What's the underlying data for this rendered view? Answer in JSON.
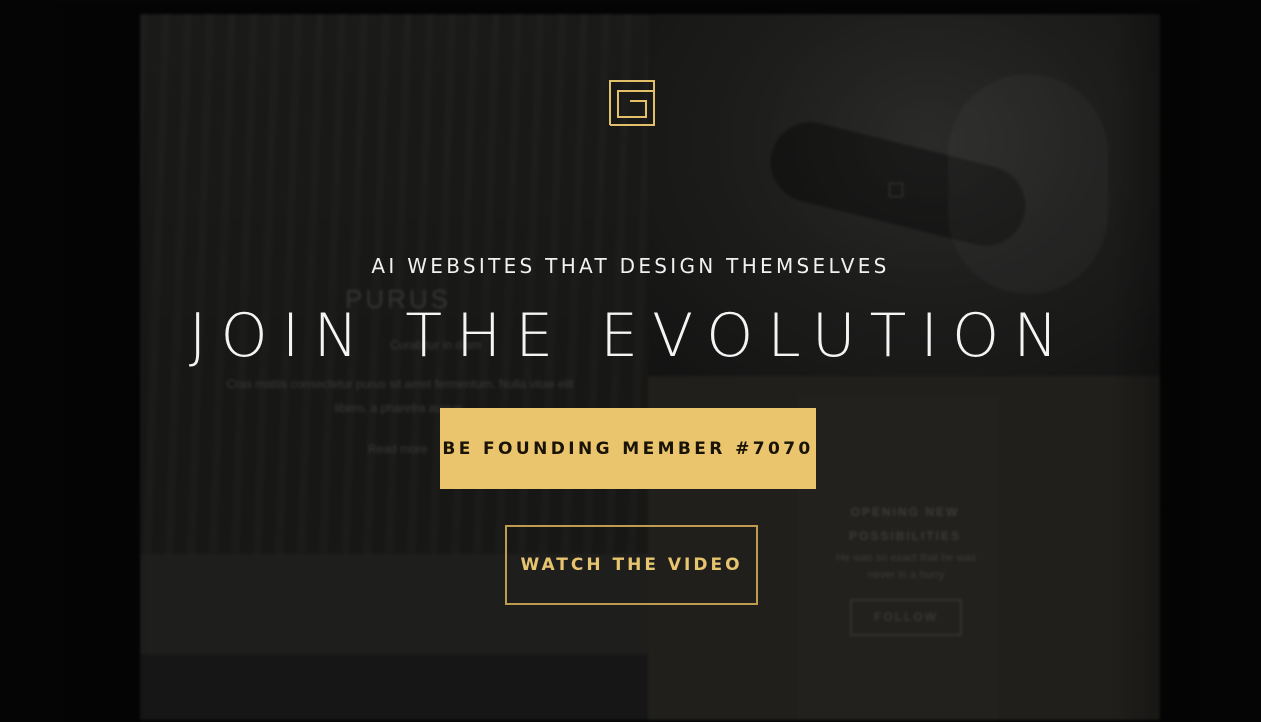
{
  "background_mockup": {
    "left_heading": "PURUS",
    "left_subheading": "Curabitur in diam",
    "left_body": "Cras mattis consectetur purus sit amet fermentum. Nulla vitae elit libero, a pharetra augue.",
    "left_link": "Read more",
    "right_heading": "OPENING NEW POSSIBILITIES",
    "right_body": "He was so exact that he was never in a hurry",
    "right_button": "FOLLOW"
  },
  "hero": {
    "logo_icon": "g-logo-icon",
    "tagline": "AI WEBSITES THAT DESIGN THEMSELVES",
    "headline": "JOIN THE EVOLUTION",
    "primary_cta": "BE FOUNDING MEMBER #7070",
    "secondary_cta": "WATCH THE VIDEO"
  },
  "colors": {
    "accent": "#eac56e",
    "accent_border": "#bf9b50",
    "background": "#070707",
    "text": "#f4f4f4"
  }
}
